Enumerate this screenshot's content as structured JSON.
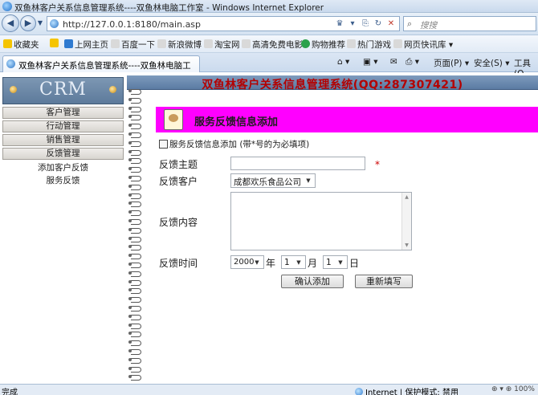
{
  "window": {
    "title": "双鱼林客户关系信息管理系统----双鱼林电脑工作室 - Windows Internet Explorer"
  },
  "address": {
    "url": "http://127.0.0.1:8180/main.asp",
    "search_placeholder": "搜搜"
  },
  "favorites": {
    "label": "收藏夹",
    "items": [
      "上网主页",
      "百度一下",
      "新浪微博",
      "淘宝网",
      "高清免费电影",
      "购物推荐",
      "热门游戏",
      "网页快讯库 ▾"
    ]
  },
  "tab": {
    "label": "双鱼林客户关系信息管理系统----双鱼林电脑工作..."
  },
  "commands": {
    "page": "页面(P) ▾",
    "safety": "安全(S) ▾",
    "tools": "工具(O"
  },
  "sidebar": {
    "logo": "CRM",
    "menus": [
      "客户管理",
      "行动管理",
      "销售管理",
      "反馈管理"
    ],
    "subitems": [
      "添加客户反馈",
      "服务反馈"
    ]
  },
  "header": {
    "system_title": "双鱼林客户关系信息管理系统(QQ:287307421)"
  },
  "form": {
    "banner_title": "服务反馈信息添加",
    "note": "服务反馈信息添加 (带*号的为必填项)",
    "subject_label": "反馈主题",
    "subject_value": "",
    "required_mark": "*",
    "customer_label": "反馈客户",
    "customer_value": "成都欢乐食品公司",
    "content_label": "反馈内容",
    "content_value": "",
    "time_label": "反馈时间",
    "year_value": "2000",
    "year_unit": "年",
    "month_value": "1",
    "month_unit": "月",
    "day_value": "1",
    "day_unit": "日",
    "submit_label": "确认添加",
    "reset_label": "重新填写"
  },
  "status": {
    "text": "完成",
    "zone": "Internet | 保护模式: 禁用",
    "extra": "⊕ ▾  ⊕ 100% ▾"
  }
}
